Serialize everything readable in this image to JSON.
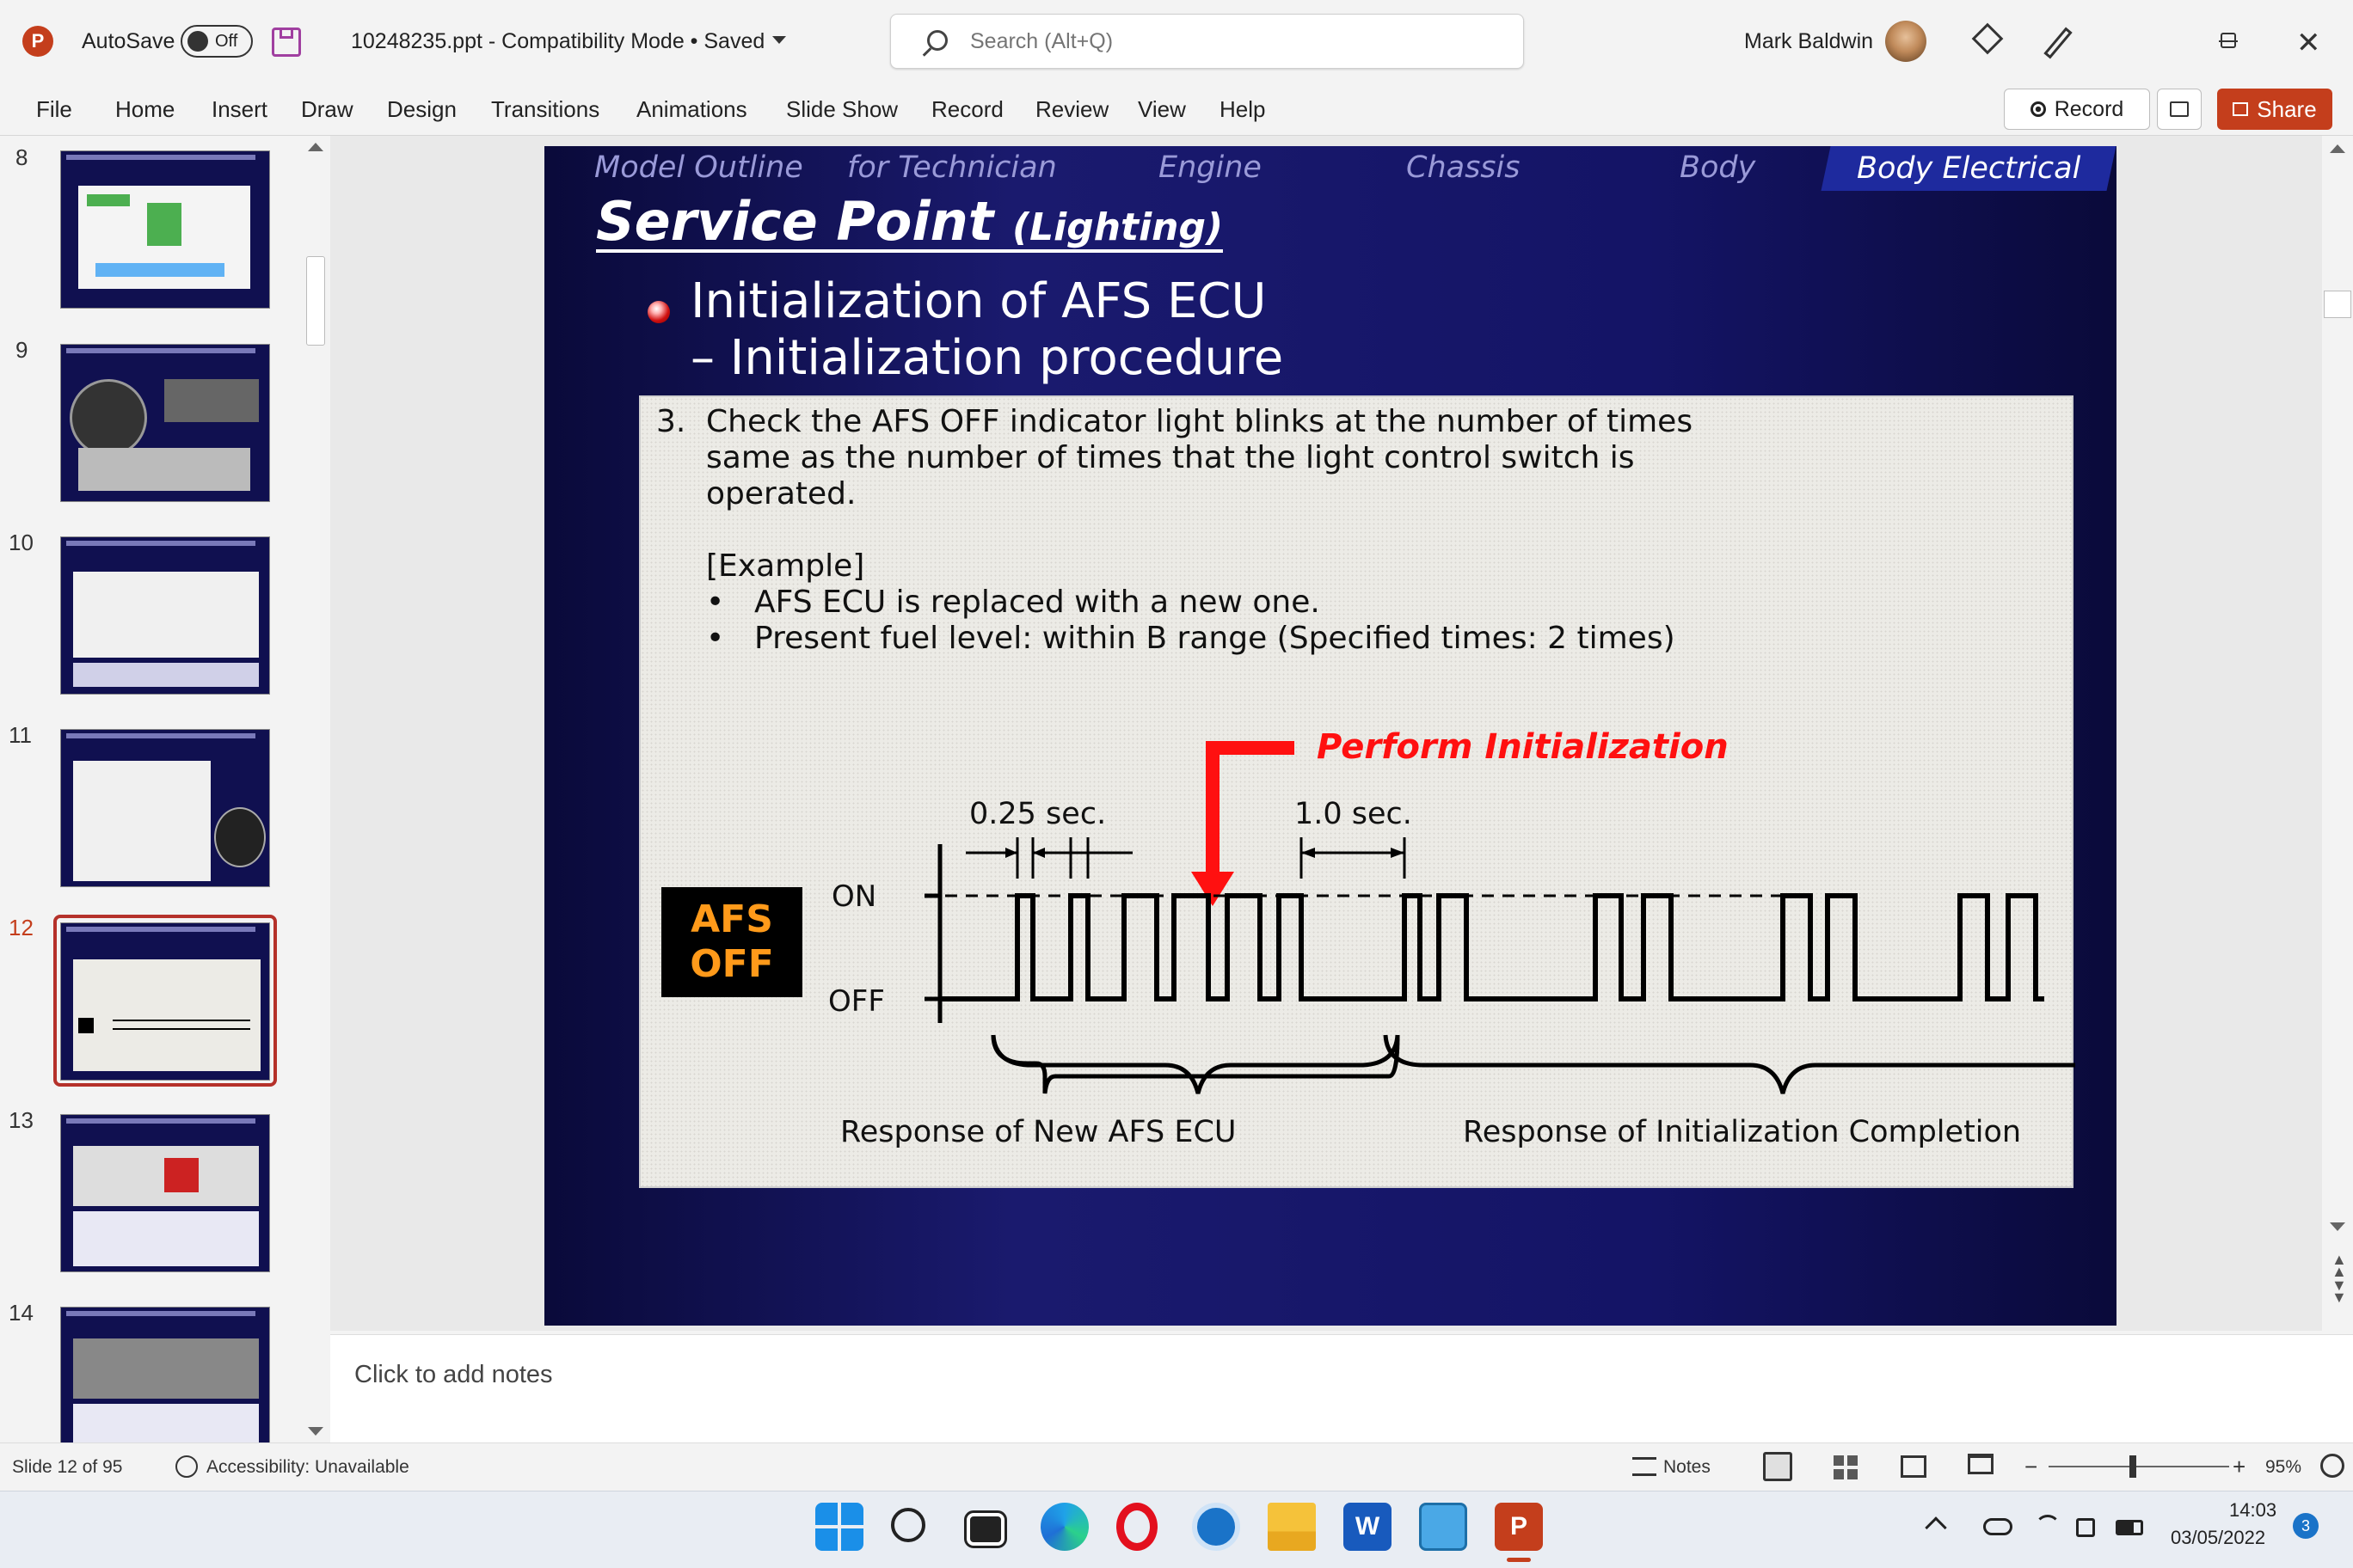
{
  "titlebar": {
    "autosave_label": "AutoSave",
    "autosave_state": "Off",
    "file_name": "10248235.ppt  -  Compatibility Mode • Saved",
    "search_placeholder": "Search (Alt+Q)",
    "user_name": "Mark Baldwin"
  },
  "ribbon": {
    "tabs": [
      "File",
      "Home",
      "Insert",
      "Draw",
      "Design",
      "Transitions",
      "Animations",
      "Slide Show",
      "Record",
      "Review",
      "View",
      "Help"
    ],
    "record_label": "Record",
    "share_label": "Share"
  },
  "thumbnails": {
    "numbers": [
      "8",
      "9",
      "10",
      "11",
      "12",
      "13",
      "14"
    ],
    "selected": "12"
  },
  "slide": {
    "nav": [
      "Model Outline",
      "for Technician",
      "Engine",
      "Chassis",
      "Body",
      "Body Electrical"
    ],
    "title_main": "Service Point",
    "title_sub": "(Lighting)",
    "heading_line1": "Initialization of AFS ECU",
    "heading_line2": "– Initialization procedure",
    "step_number": "3.",
    "step_line1": "Check the AFS OFF indicator light blinks at the number of times",
    "step_line2": "same as the number of times that the light control switch is",
    "step_line3": "operated.",
    "example_label": "[Example]",
    "example_items": [
      "AFS ECU is replaced with a new one.",
      "Present fuel level: within B range (Specified times: 2 times)"
    ],
    "perform_label": "Perform Initialization",
    "interval_short": "0.25 sec.",
    "interval_long": "1.0 sec.",
    "level_on": "ON",
    "level_off": "OFF",
    "indicator_line1": "AFS",
    "indicator_line2": "OFF",
    "response_new": "Response of New AFS ECU",
    "response_init": "Response of Initialization Completion"
  },
  "notes": {
    "placeholder": "Click to add notes"
  },
  "status": {
    "slide_count": "Slide 12 of 95",
    "accessibility": "Accessibility: Unavailable",
    "notes_label": "Notes",
    "zoom": "95%"
  },
  "taskbar": {
    "time": "14:03",
    "date": "03/05/2022",
    "notification_count": "3"
  },
  "colors": {
    "accent": "#c43e1c",
    "slide_bg": "#141466",
    "highlight_red": "#ff1010",
    "indicator_text": "#ff9a1a"
  }
}
